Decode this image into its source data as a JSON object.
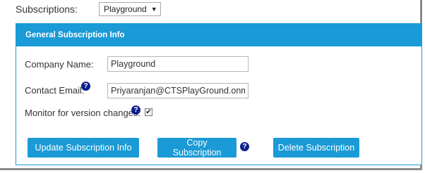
{
  "subscriptions": {
    "label": "Subscriptions:",
    "selected": "Playground",
    "caret": "▼"
  },
  "panel": {
    "title": "General Subscription Info"
  },
  "form": {
    "company_label": "Company Name:",
    "company_value": "Playground",
    "email_label": "Contact Email:",
    "email_value": "Priyaranjan@CTSPlayGround.onmicro",
    "monitor_label": "Monitor for version changes:",
    "monitor_checked": true,
    "check_glyph": "✔",
    "help_glyph": "?"
  },
  "buttons": {
    "update": "Update Subscription Info",
    "copy": "Copy Subscription",
    "delete": "Delete Subscription"
  },
  "colors": {
    "accent": "#1a9ad6",
    "help_icon": "#0d1f8c"
  },
  "icons": {
    "help": "question-circle-icon",
    "checkbox": "checkmark-icon",
    "dropdown": "caret-down-icon"
  }
}
